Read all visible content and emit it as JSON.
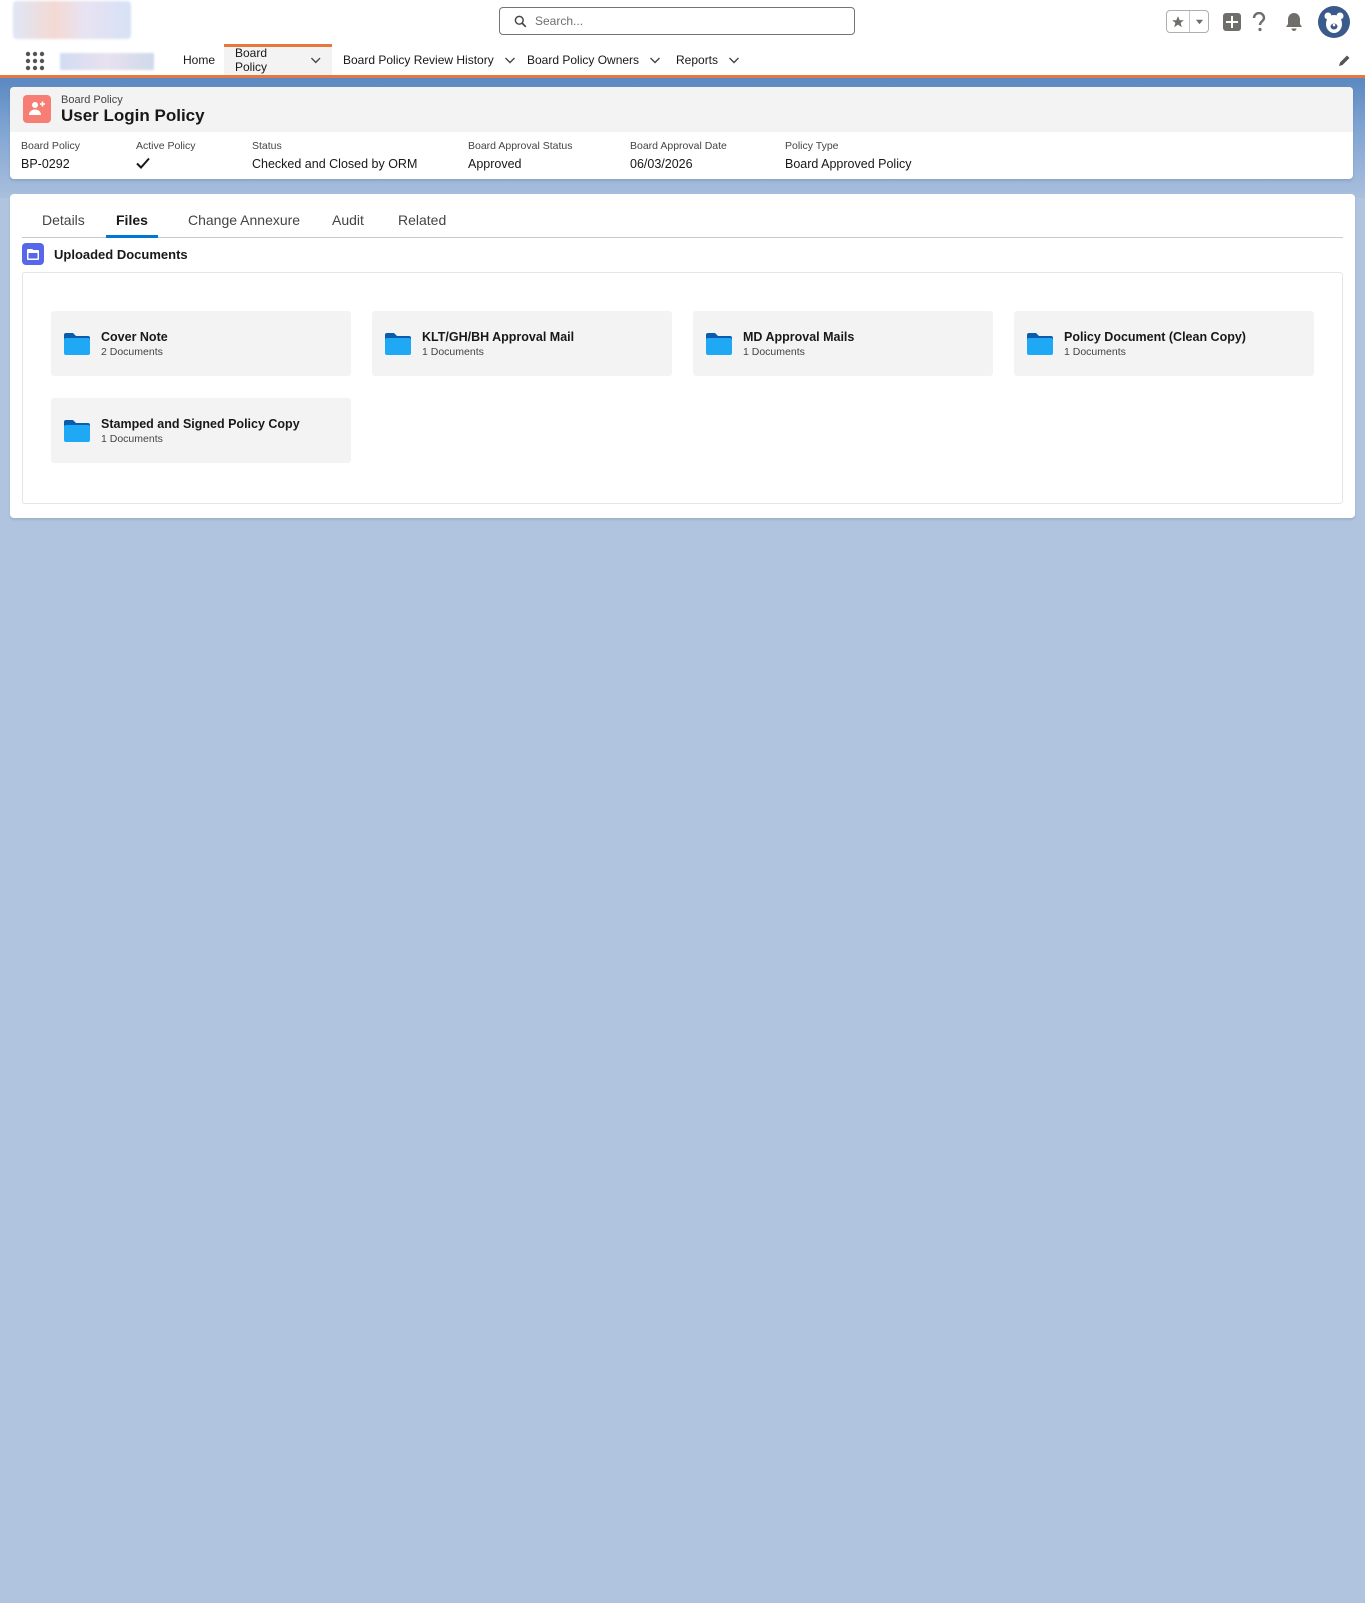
{
  "header": {
    "search_placeholder": "Search..."
  },
  "nav": {
    "items": [
      {
        "label": "Home"
      },
      {
        "label": "Board Policy"
      },
      {
        "label": "Board Policy Review History"
      },
      {
        "label": "Board Policy Owners"
      },
      {
        "label": "Reports"
      }
    ]
  },
  "record": {
    "object_label": "Board Policy",
    "title": "User Login Policy",
    "fields": [
      {
        "label": "Board Policy",
        "value": "BP-0292"
      },
      {
        "label": "Active Policy",
        "value": "checked"
      },
      {
        "label": "Status",
        "value": "Checked and Closed by ORM"
      },
      {
        "label": "Board Approval Status",
        "value": "Approved"
      },
      {
        "label": "Board Approval Date",
        "value": "06/03/2026"
      },
      {
        "label": "Policy Type",
        "value": "Board Approved Policy"
      }
    ]
  },
  "tabs": [
    {
      "label": "Details"
    },
    {
      "label": "Files",
      "active": true
    },
    {
      "label": "Change Annexure"
    },
    {
      "label": "Audit"
    },
    {
      "label": "Related"
    }
  ],
  "section": {
    "title": "Uploaded Documents"
  },
  "folders": [
    {
      "name": "Cover Note",
      "count": "2 Documents"
    },
    {
      "name": "KLT/GH/BH Approval Mail",
      "count": "1 Documents"
    },
    {
      "name": "MD Approval Mails",
      "count": "1 Documents"
    },
    {
      "name": "Policy Document (Clean Copy)",
      "count": "1 Documents"
    },
    {
      "name": "Stamped and Signed Policy Copy",
      "count": "1 Documents"
    }
  ],
  "colors": {
    "accent": "#e8773f",
    "tab_active": "#0176d3",
    "record_icon": "#f77e75",
    "section_icon": "#5867e8",
    "folder_icon": "#1fa9f4",
    "page_background": "#b0c4df"
  }
}
